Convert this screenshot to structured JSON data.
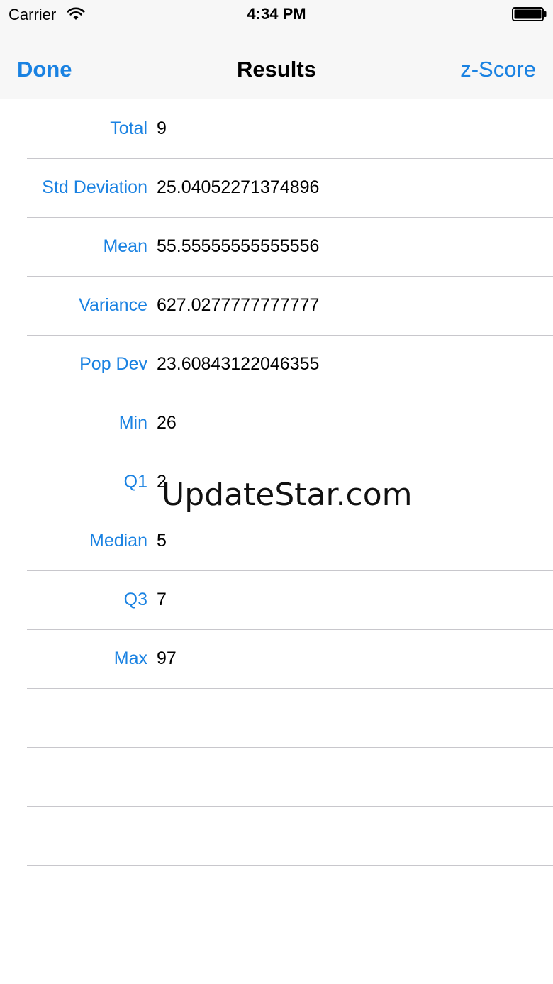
{
  "status_bar": {
    "carrier": "Carrier",
    "time": "4:34 PM",
    "icons": [
      "wifi-icon",
      "battery-icon"
    ]
  },
  "nav": {
    "left_button": "Done",
    "title": "Results",
    "right_button": "z-Score"
  },
  "colors": {
    "accent": "#1a82e2",
    "bar_background": "#f7f7f7",
    "separator": "#c8c7cc"
  },
  "results": [
    {
      "label": "Total",
      "value": "9"
    },
    {
      "label": "Std Deviation",
      "value": "25.04052271374896"
    },
    {
      "label": "Mean",
      "value": "55.55555555555556"
    },
    {
      "label": "Variance",
      "value": "627.0277777777777"
    },
    {
      "label": "Pop Dev",
      "value": "23.60843122046355"
    },
    {
      "label": "Min",
      "value": "26"
    },
    {
      "label": "Q1",
      "value": "2"
    },
    {
      "label": "Median",
      "value": "5"
    },
    {
      "label": "Q3",
      "value": "7"
    },
    {
      "label": "Max",
      "value": "97"
    },
    {
      "label": "",
      "value": ""
    },
    {
      "label": "",
      "value": ""
    },
    {
      "label": "",
      "value": ""
    },
    {
      "label": "",
      "value": ""
    },
    {
      "label": "",
      "value": ""
    }
  ],
  "watermark": "UpdateStar.com"
}
